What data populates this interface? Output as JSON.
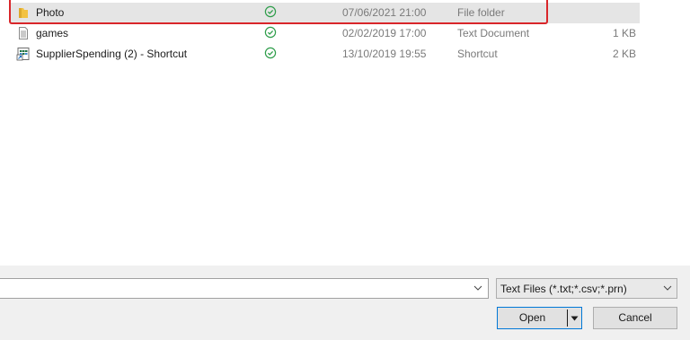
{
  "files": [
    {
      "name": "Photo",
      "icon": "folder-icon",
      "status_icon": "sync-ok-icon",
      "date": "07/06/2021 21:00",
      "type": "File folder",
      "size": ""
    },
    {
      "name": "games",
      "icon": "text-file-icon",
      "status_icon": "sync-ok-icon",
      "date": "02/02/2019 17:00",
      "type": "Text Document",
      "size": "1 KB"
    },
    {
      "name": "SupplierSpending (2) - Shortcut",
      "icon": "excel-shortcut-icon",
      "status_icon": "sync-ok-icon",
      "date": "13/10/2019 19:55",
      "type": "Shortcut",
      "size": "2 KB"
    }
  ],
  "footer": {
    "filename_value": "",
    "filter_label": "Text Files (*.txt;*.csv;*.prn)",
    "open_label": "Open",
    "cancel_label": "Cancel"
  },
  "colors": {
    "highlight": "#d9262a",
    "selected_row": "#e5e5e5",
    "status_green": "#2e9d4a",
    "folder_yellow": "#f3c241",
    "focus_border": "#0078d7"
  }
}
